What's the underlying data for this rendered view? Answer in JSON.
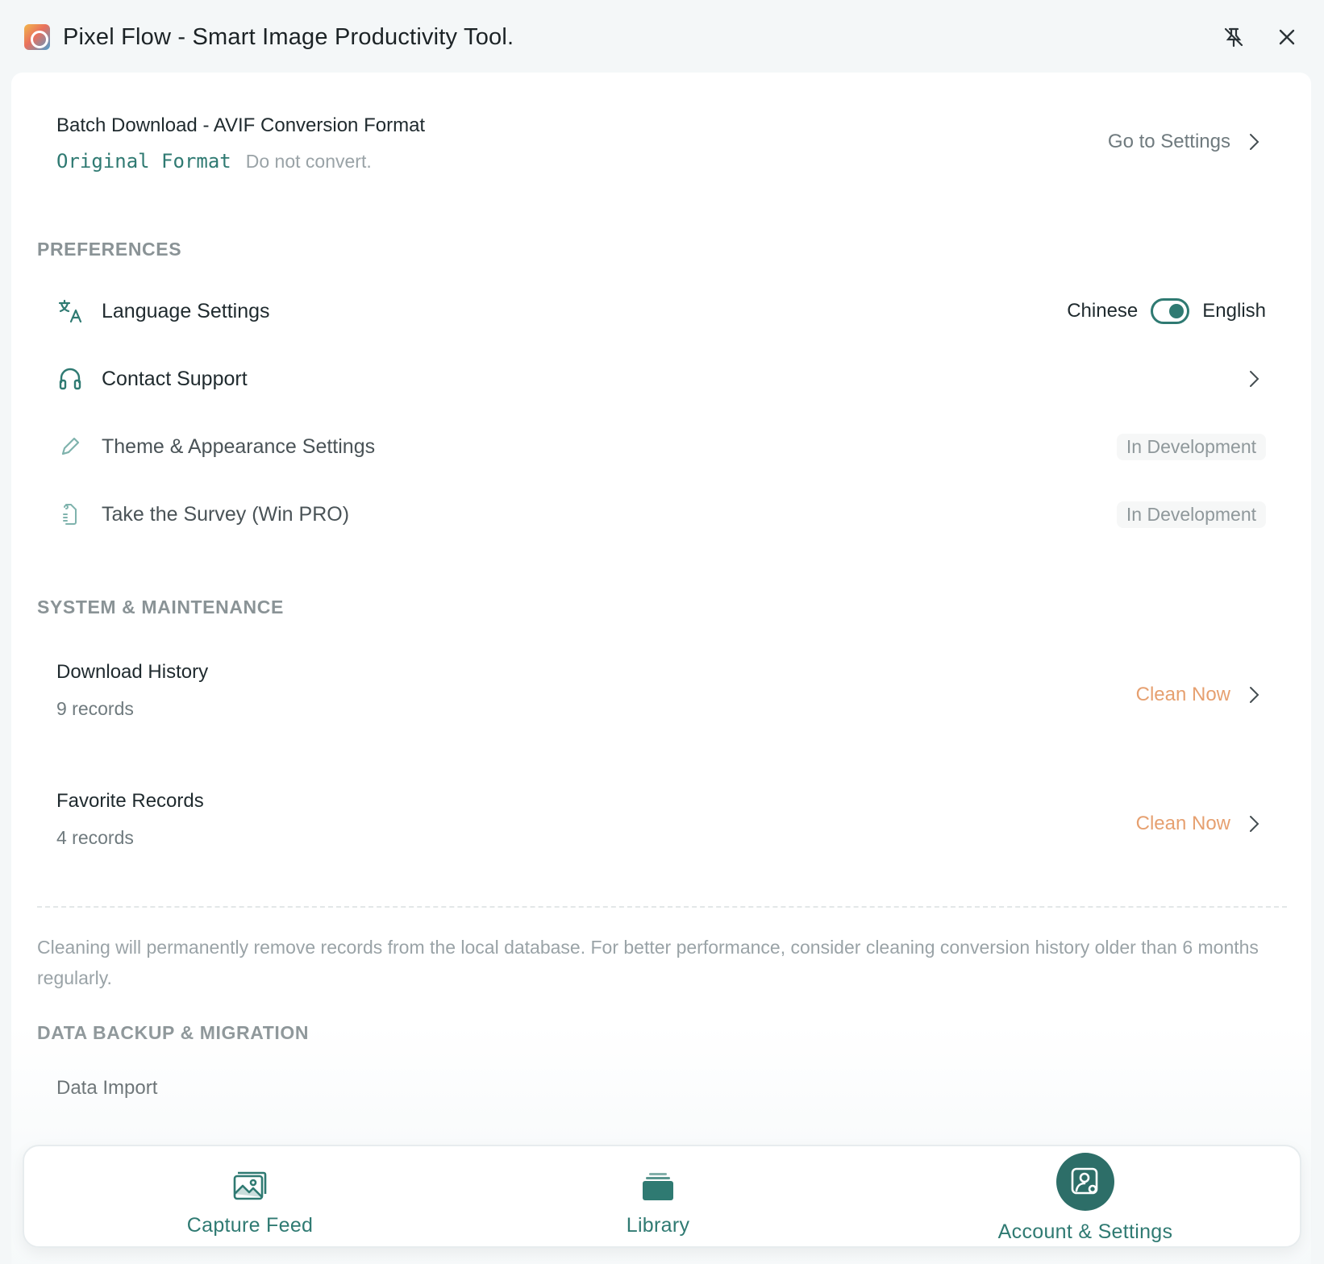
{
  "app": {
    "title": "Pixel Flow - Smart Image Productivity Tool.",
    "logo_icon": "app-logo-icon",
    "accent_color": "#2f7a72"
  },
  "title_actions": {
    "unpin_icon": "unpin-icon",
    "close_icon": "close-icon"
  },
  "batch": {
    "title": "Batch Download - AVIF Conversion Format",
    "format": "Original Format",
    "note": "Do not convert.",
    "link": "Go to Settings"
  },
  "preferences": {
    "header": "PREFERENCES",
    "language": {
      "label": "Language Settings",
      "left_option": "Chinese",
      "right_option": "English",
      "toggle_on": true
    },
    "support": {
      "label": "Contact Support"
    },
    "theme": {
      "label": "Theme & Appearance Settings",
      "badge": "In Development"
    },
    "survey": {
      "label": "Take the Survey (Win PRO)",
      "badge": "In Development"
    }
  },
  "system": {
    "header": "SYSTEM & MAINTENANCE",
    "download_history": {
      "title": "Download History",
      "count": "9 records",
      "action": "Clean Now"
    },
    "favorites": {
      "title": "Favorite Records",
      "count": "4 records",
      "action": "Clean Now"
    },
    "notice": "Cleaning will permanently remove records from the local database. For better performance, consider cleaning conversion history older than 6 months regularly."
  },
  "backup": {
    "header": "DATA BACKUP & MIGRATION",
    "import_title": "Data Import"
  },
  "bottom_nav": {
    "items": [
      {
        "label": "Capture Feed",
        "icon": "image-icon",
        "active": false
      },
      {
        "label": "Library",
        "icon": "stack-icon",
        "active": false
      },
      {
        "label": "Account & Settings",
        "icon": "account-settings-icon",
        "active": true
      }
    ]
  }
}
